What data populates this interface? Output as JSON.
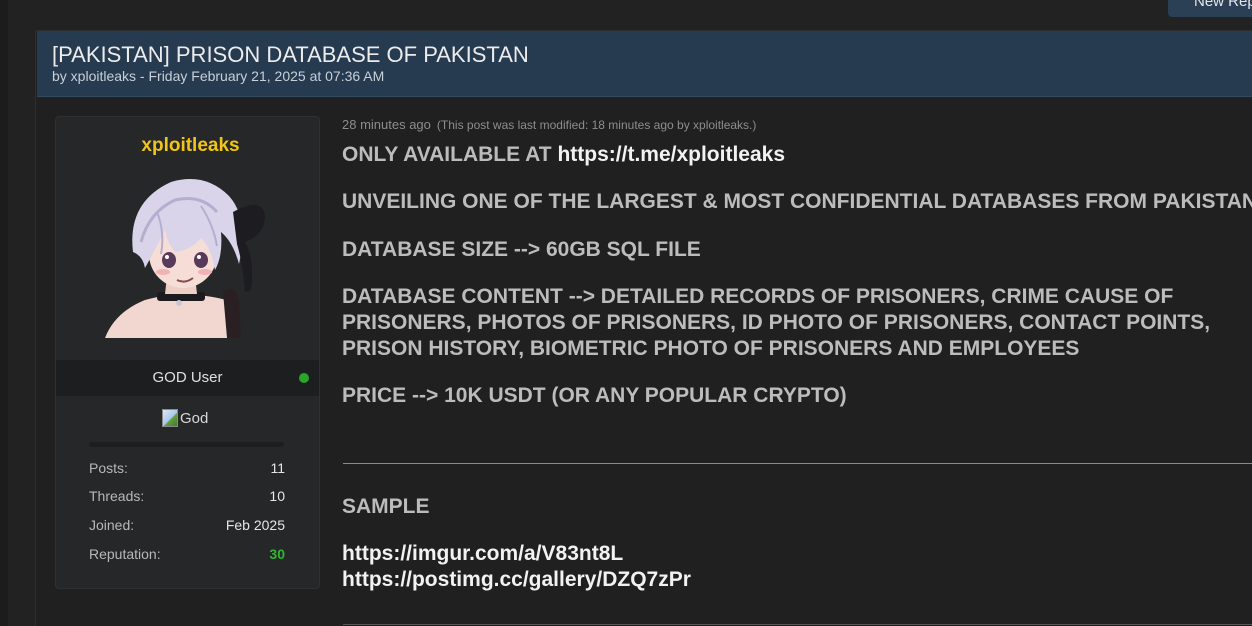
{
  "top": {
    "new_reply_label": "New Reply"
  },
  "thread": {
    "title": "[PAKISTAN] PRISON DATABASE OF PAKISTAN",
    "byline": "by xploitleaks - Friday February 21, 2025 at 07:36 AM"
  },
  "author": {
    "icon": "",
    "name": "xploitleaks",
    "usergroup": "GOD User",
    "group_image_alt": "God",
    "stats": [
      {
        "label": "Posts:",
        "value": "11"
      },
      {
        "label": "Threads:",
        "value": "10"
      },
      {
        "label": "Joined:",
        "value": "Feb 2025"
      },
      {
        "label": "Reputation:",
        "value": "30"
      }
    ]
  },
  "post": {
    "time": "28 minutes ago",
    "modified": "(This post was last modified: 18 minutes ago by xploitleaks.)",
    "line1_prefix": "ONLY AVAILABLE AT ",
    "line1_link": "https://t.me/xploitleaks",
    "line2": "UNVEILING ONE OF THE LARGEST & MOST CONFIDENTIAL DATABASES FROM PAKISTAN",
    "line3": "DATABASE SIZE --> 60GB SQL FILE",
    "line4a": "DATABASE CONTENT --> DETAILED RECORDS OF PRISONERS, CRIME CAUSE OF",
    "line4b": "PRISONERS, PHOTOS OF PRISONERS, ID PHOTO OF PRISONERS, CONTACT POINTS,",
    "line4c": "PRISON HISTORY, BIOMETRIC PHOTO OF PRISONERS AND EMPLOYEES",
    "line5": "PRICE --> 10K USDT (OR ANY POPULAR CRYPTO)",
    "sample_heading": "SAMPLE",
    "sample_link1": "https://imgur.com/a/V83nt8L",
    "sample_link2": "https://postimg.cc/gallery/DZQ7zPr"
  },
  "colors": {
    "header_bg": "#263a50",
    "author_name": "#f0c419",
    "reputation": "#2cb82c",
    "online": "#2aa52a"
  }
}
